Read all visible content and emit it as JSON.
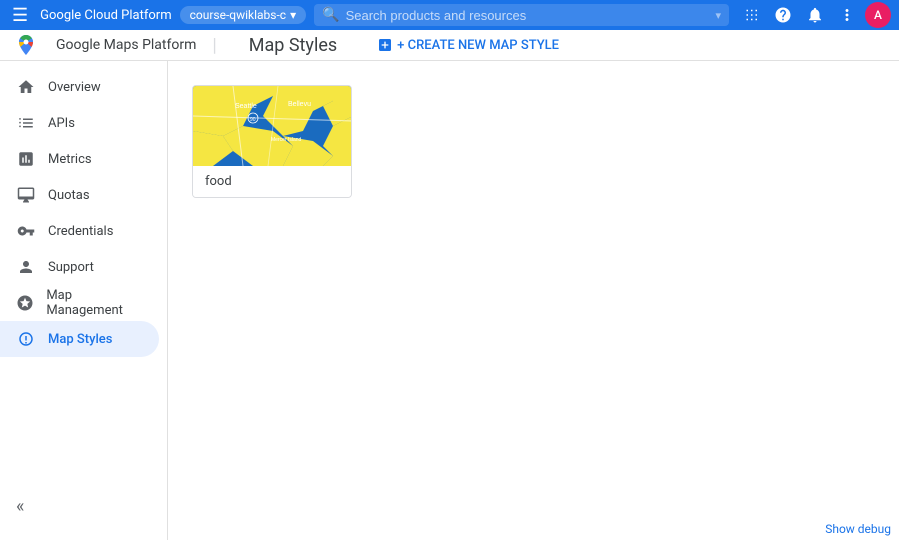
{
  "topNav": {
    "hamburger": "☰",
    "brandTitle": "Google Cloud Platform",
    "projectChip": "course-qwiklabs-c",
    "searchPlaceholder": "Search products and resources",
    "icons": {
      "grid": "⊞",
      "help": "?",
      "bell": "🔔",
      "more": "⋮"
    },
    "avatarInitial": "A"
  },
  "secondaryNav": {
    "appTitle": "Google Maps Platform",
    "pageTitle": "Map Styles",
    "createButton": "+ CREATE NEW MAP STYLE"
  },
  "sidebar": {
    "items": [
      {
        "id": "overview",
        "label": "Overview",
        "icon": "home"
      },
      {
        "id": "apis",
        "label": "APIs",
        "icon": "list"
      },
      {
        "id": "metrics",
        "label": "Metrics",
        "icon": "bar_chart"
      },
      {
        "id": "quotas",
        "label": "Quotas",
        "icon": "desktop"
      },
      {
        "id": "credentials",
        "label": "Credentials",
        "icon": "vpn_key"
      },
      {
        "id": "support",
        "label": "Support",
        "icon": "person"
      },
      {
        "id": "map-management",
        "label": "Map Management",
        "icon": "layers"
      },
      {
        "id": "map-styles",
        "label": "Map Styles",
        "icon": "palette",
        "active": true
      }
    ],
    "collapseIcon": "«"
  },
  "content": {
    "mapStyleCard": {
      "label": "food"
    }
  },
  "debugBar": {
    "label": "Show debug"
  }
}
